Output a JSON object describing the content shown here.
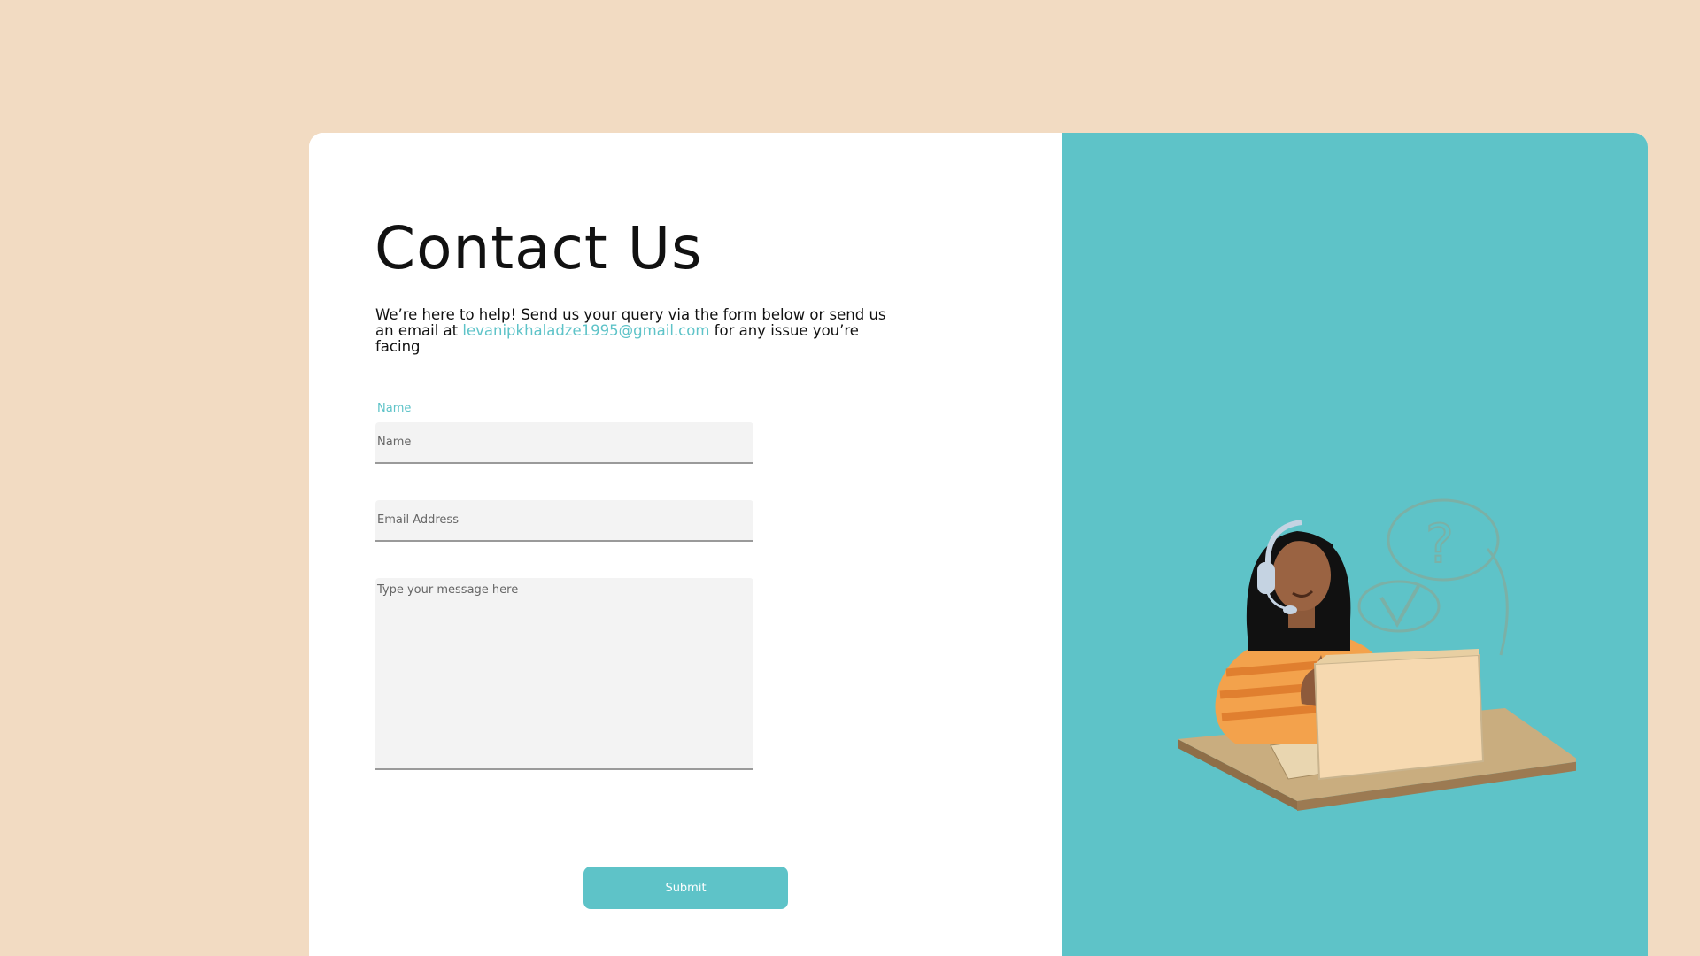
{
  "header": {
    "title": "Contact Us",
    "intro_before": "We’re here to help! Send us your query via the form below or send us an email at ",
    "intro_email": "levanipkhaladze1995@gmail.com",
    "intro_after": " for any issue you’re facing"
  },
  "form": {
    "name_label": "Name",
    "name_placeholder": "Name",
    "email_placeholder": "Email Address",
    "message_placeholder": "Type your message here",
    "submit_label": "Submit"
  },
  "colors": {
    "background": "#f2dbc2",
    "accent": "#5ec3c8",
    "card": "#ffffff"
  },
  "illustration": {
    "icon": "support-agent-illustration"
  }
}
